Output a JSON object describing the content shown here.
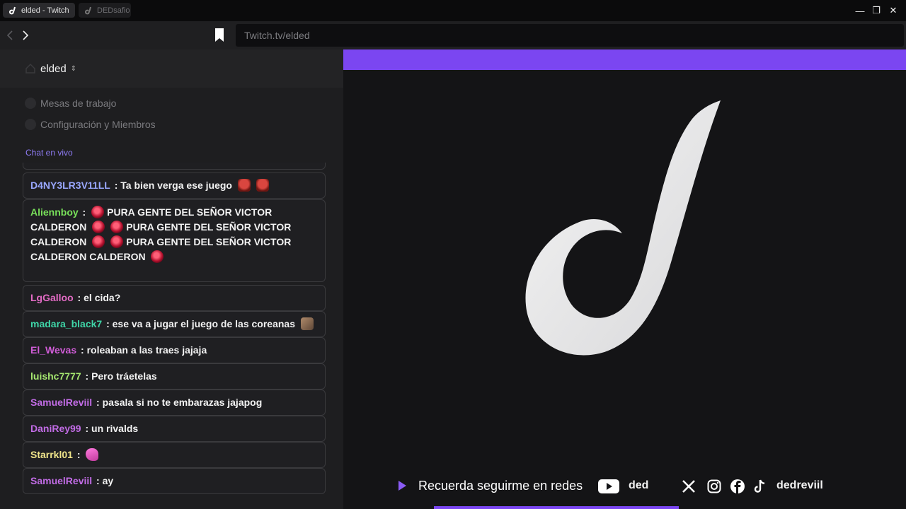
{
  "tabs": [
    {
      "label": "elded - Twitch",
      "active": true
    },
    {
      "label": "DEDsafio",
      "active": false
    }
  ],
  "window_controls": {
    "minimize": "—",
    "restore": "❐",
    "close": "✕"
  },
  "nav": {
    "back": "‹",
    "forward": "›",
    "url": "Twitch.tv/elded"
  },
  "workspace": {
    "name": "elded",
    "chevron": "⌃⌄"
  },
  "menu": [
    {
      "label": "Mesas de trabajo",
      "icon": "table-icon"
    },
    {
      "label": "Configuración y Miembros",
      "icon": "gear-icon"
    }
  ],
  "chat": {
    "label": "Chat en vivo",
    "messages": [
      {
        "user": "D4NY3LR3V11LL",
        "color": "#9aa8ff",
        "text": "Ta bien verga ese juego"
      },
      {
        "user": "Aliennboy",
        "color": "#78e05a",
        "text": "PURA GENTE DEL SEÑOR VICTOR CALDERON",
        "repeat": "PURA GENTE DEL SEÑOR VICTOR CALDERON",
        "tail": "CALDERON"
      },
      {
        "user": "LgGalloo",
        "color": "#e46cc6",
        "text": "el cida?"
      },
      {
        "user": "madara_black7",
        "color": "#3fd6a8",
        "text": "ese va a jugar el juego de las coreanas"
      },
      {
        "user": "El_Wevas",
        "color": "#cf5cd6",
        "text": "roleaban a las traes jajaja"
      },
      {
        "user": "luishc7777",
        "color": "#a6e870",
        "text": "Pero tráetelas"
      },
      {
        "user": "SamuelReviil",
        "color": "#c26ce6",
        "text": "pasala si no te embarazas jajapog"
      },
      {
        "user": "DaniRey99",
        "color": "#c26ce6",
        "text": "un rivalds"
      },
      {
        "user": "Starrkl01",
        "color": "#efe48a",
        "text": ""
      },
      {
        "user": "SamuelReviil",
        "color": "#c26ce6",
        "text": "ay"
      }
    ]
  },
  "stream": {
    "accent": "#7b46f1",
    "footer_text": "Recuerda seguirme en redes",
    "youtube_handle": "ded",
    "other_handle": "dedreviil"
  }
}
